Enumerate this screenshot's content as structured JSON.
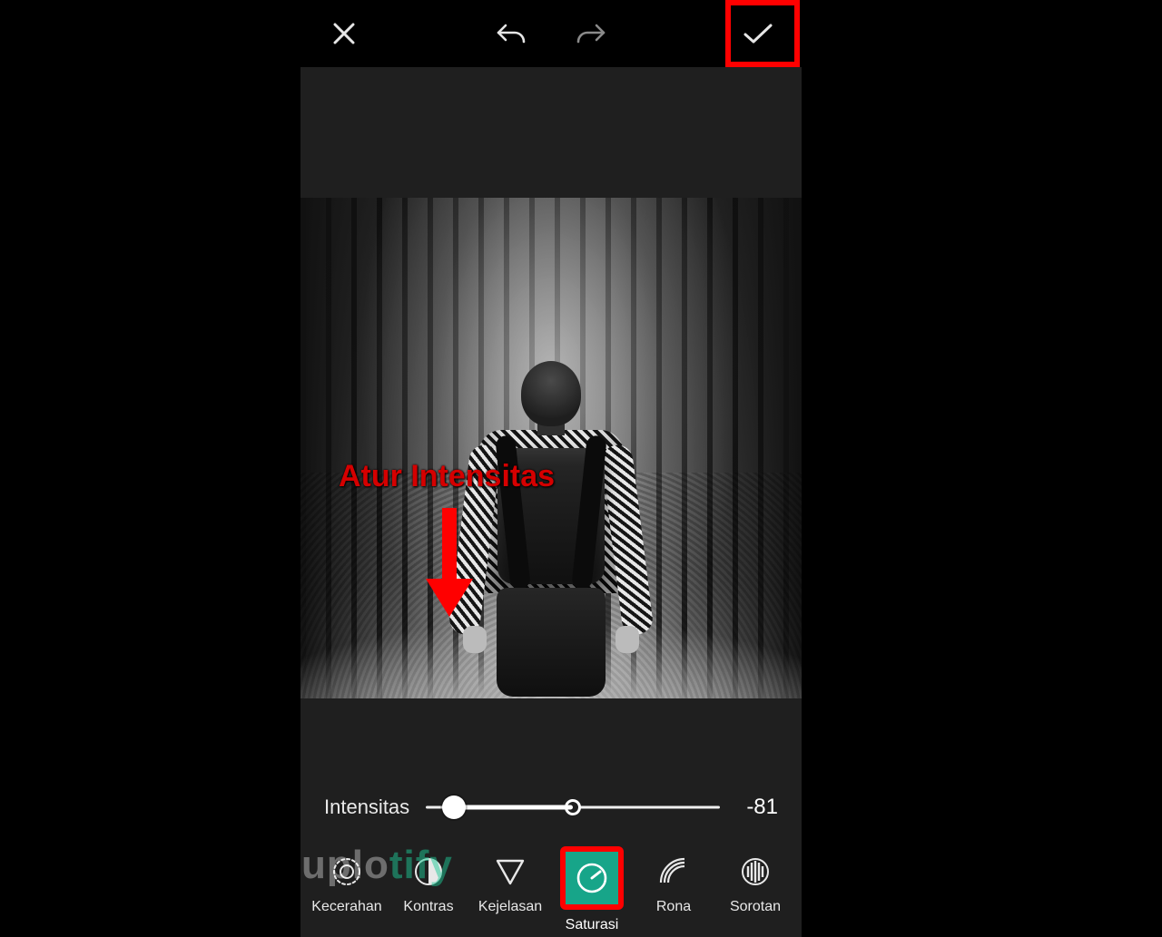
{
  "annotation": {
    "label": "Atur Intensitas"
  },
  "slider": {
    "label": "Intensitas",
    "value": "-81",
    "min": -100,
    "max": 100,
    "current": -81
  },
  "tools": {
    "brightness": "Kecerahan",
    "contrast": "Kontras",
    "clarity": "Kejelasan",
    "saturation": "Saturasi",
    "hue": "Rona",
    "highlights": "Sorotan",
    "active": "saturation"
  },
  "watermark": {
    "part1": "uplo",
    "part2": "tify"
  }
}
